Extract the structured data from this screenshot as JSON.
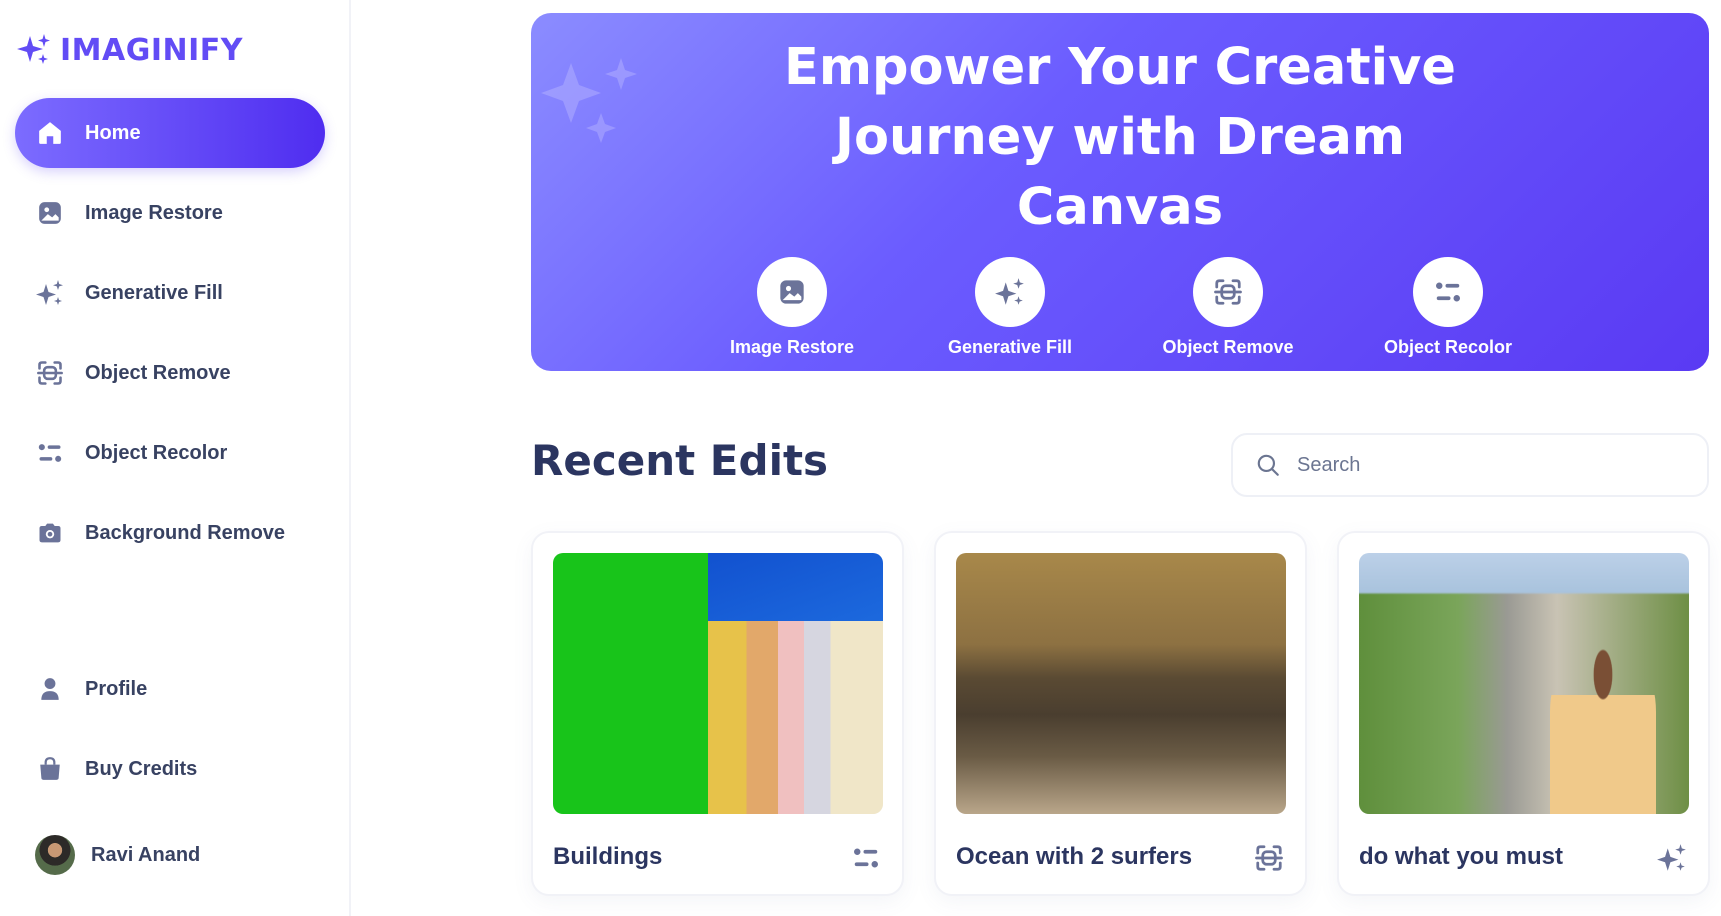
{
  "app": {
    "brand": "IMAGINIFY",
    "accent": "#624cf5"
  },
  "sidebar": {
    "items": [
      {
        "label": "Home",
        "icon": "home-icon",
        "active": true
      },
      {
        "label": "Image Restore",
        "icon": "image-icon"
      },
      {
        "label": "Generative Fill",
        "icon": "sparkles-icon"
      },
      {
        "label": "Object Remove",
        "icon": "scan-icon"
      },
      {
        "label": "Object Recolor",
        "icon": "filter-icon"
      },
      {
        "label": "Background Remove",
        "icon": "camera-icon"
      }
    ],
    "bottom_items": [
      {
        "label": "Profile",
        "icon": "profile-icon"
      },
      {
        "label": "Buy Credits",
        "icon": "bag-icon"
      }
    ],
    "user": {
      "name": "Ravi Anand"
    }
  },
  "banner": {
    "title_lines": [
      "Empower Your Creative",
      "Journey with Dream",
      "Canvas"
    ],
    "tools": [
      {
        "label": "Image Restore",
        "icon": "image-icon"
      },
      {
        "label": "Generative Fill",
        "icon": "sparkles-icon"
      },
      {
        "label": "Object Remove",
        "icon": "scan-icon"
      },
      {
        "label": "Object Recolor",
        "icon": "filter-icon"
      }
    ]
  },
  "recent": {
    "title": "Recent Edits",
    "search": {
      "placeholder": "Search",
      "value": ""
    },
    "cards": [
      {
        "title": "Buildings",
        "icon": "filter-icon"
      },
      {
        "title": "Ocean with 2 surfers",
        "icon": "scan-icon"
      },
      {
        "title": "do what you must",
        "icon": "sparkles-icon"
      }
    ]
  }
}
